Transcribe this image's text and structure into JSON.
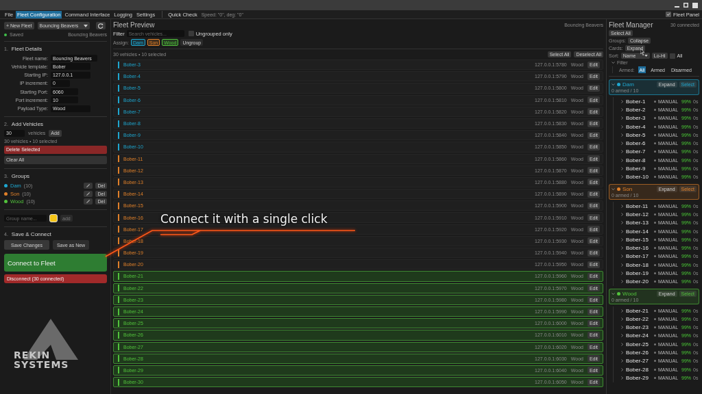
{
  "fleet_panel_toggle": {
    "label": "Fleet Panel",
    "checked": true
  },
  "menu": [
    {
      "label": "File",
      "selected": false
    },
    {
      "label": "Fleet Configuration",
      "selected": true
    },
    {
      "label": "Command Interface",
      "selected": false
    },
    {
      "label": "Logging",
      "selected": false
    },
    {
      "label": "Settings",
      "selected": false
    }
  ],
  "quick_check": {
    "label": "Quick Check",
    "status": "Speed: \"0\", deg: \"0\""
  },
  "left": {
    "new_fleet": "+ New Fleet",
    "fleet_select": "Bouncing Beavers",
    "save_status": "Saved",
    "saved": true,
    "fleet_hint": "Bouncing Beavers",
    "details": {
      "number": "1.",
      "title": "Fleet Details",
      "fields": [
        {
          "label": "Fleet name:",
          "value": "Bouncing Beavers"
        },
        {
          "label": "Vehicle template:",
          "value": "Bober"
        },
        {
          "label": "Starting IP:",
          "value": "127.0.0.1"
        },
        {
          "label": "IP increment:",
          "value": "0"
        },
        {
          "label": "Starting Port:",
          "value": "6060"
        },
        {
          "label": "Port increment:",
          "value": "10"
        },
        {
          "label": "Payload Type:",
          "value": "Wood"
        }
      ]
    },
    "add": {
      "number": "2.",
      "title": "Add Vehicles",
      "count": "30",
      "unit": "vehicles",
      "add_button": "Add",
      "summary": "30 vehicles • 10 selected",
      "delete_button": "Delete Selected",
      "clear_button": "Clear All"
    },
    "groups": {
      "number": "3.",
      "title": "Groups",
      "items": [
        {
          "name": "Dam",
          "count": "(10)",
          "color": "#1ea7d0",
          "delete": "Del"
        },
        {
          "name": "Son",
          "count": "(10)",
          "color": "#e0802a",
          "delete": "Del"
        },
        {
          "name": "Wood",
          "count": "(10)",
          "color": "#52c23c",
          "delete": "Del"
        }
      ],
      "new_group": {
        "placeholder": "Group name...",
        "color": "#f5c518",
        "add_button": "add"
      }
    },
    "save": {
      "number": "4.",
      "title": "Save & Connect",
      "save_changes": "Save Changes",
      "save_new": "Save as New",
      "connect": "Connect to Fleet",
      "disconnect": "Disconnect (30 connected)"
    },
    "logo": {
      "line1": "REKIN",
      "line2": "SYSTEMS"
    }
  },
  "preview": {
    "title": "Fleet Preview",
    "fleet": "Bouncing Beavers",
    "filter_label": "Filter",
    "search_placeholder": "Search vehicles...",
    "ungrouped": {
      "label": "Ungrouped only",
      "checked": false
    },
    "assign_label": "Assign:",
    "assign": [
      {
        "label": "Dam",
        "color": "#1ea7d0"
      },
      {
        "label": "Son",
        "color": "#e0802a"
      },
      {
        "label": "Wood",
        "color": "#52c23c"
      }
    ],
    "ungroup": "Ungroup",
    "summary": "30 vehicles • 10 selected",
    "select_all": "Select All",
    "deselect_all": "Deselect All",
    "rows": [
      {
        "name": "Bober-3",
        "address": "127.0.0.1:5780",
        "payload": "Wood",
        "color": "#1ea7d0",
        "selected": false,
        "edit": "Edit"
      },
      {
        "name": "Bober-4",
        "address": "127.0.0.1:5790",
        "payload": "Wood",
        "color": "#1ea7d0",
        "selected": false,
        "edit": "Edit"
      },
      {
        "name": "Bober-5",
        "address": "127.0.0.1:5800",
        "payload": "Wood",
        "color": "#1ea7d0",
        "selected": false,
        "edit": "Edit"
      },
      {
        "name": "Bober-6",
        "address": "127.0.0.1:5810",
        "payload": "Wood",
        "color": "#1ea7d0",
        "selected": false,
        "edit": "Edit"
      },
      {
        "name": "Bober-7",
        "address": "127.0.0.1:5820",
        "payload": "Wood",
        "color": "#1ea7d0",
        "selected": false,
        "edit": "Edit"
      },
      {
        "name": "Bober-8",
        "address": "127.0.0.1:5830",
        "payload": "Wood",
        "color": "#1ea7d0",
        "selected": false,
        "edit": "Edit"
      },
      {
        "name": "Bober-9",
        "address": "127.0.0.1:5840",
        "payload": "Wood",
        "color": "#1ea7d0",
        "selected": false,
        "edit": "Edit"
      },
      {
        "name": "Bober-10",
        "address": "127.0.0.1:5850",
        "payload": "Wood",
        "color": "#1ea7d0",
        "selected": false,
        "edit": "Edit"
      },
      {
        "name": "Bober-11",
        "address": "127.0.0.1:5860",
        "payload": "Wood",
        "color": "#e0802a",
        "selected": false,
        "edit": "Edit"
      },
      {
        "name": "Bober-12",
        "address": "127.0.0.1:5870",
        "payload": "Wood",
        "color": "#e0802a",
        "selected": false,
        "edit": "Edit"
      },
      {
        "name": "Bober-13",
        "address": "127.0.0.1:5880",
        "payload": "Wood",
        "color": "#e0802a",
        "selected": false,
        "edit": "Edit"
      },
      {
        "name": "Bober-14",
        "address": "127.0.0.1:5890",
        "payload": "Wood",
        "color": "#e0802a",
        "selected": false,
        "edit": "Edit"
      },
      {
        "name": "Bober-15",
        "address": "127.0.0.1:5900",
        "payload": "Wood",
        "color": "#e0802a",
        "selected": false,
        "edit": "Edit"
      },
      {
        "name": "Bober-16",
        "address": "127.0.0.1:5910",
        "payload": "Wood",
        "color": "#e0802a",
        "selected": false,
        "edit": "Edit"
      },
      {
        "name": "Bober-17",
        "address": "127.0.0.1:5920",
        "payload": "Wood",
        "color": "#e0802a",
        "selected": false,
        "edit": "Edit"
      },
      {
        "name": "Bober-18",
        "address": "127.0.0.1:5930",
        "payload": "Wood",
        "color": "#e0802a",
        "selected": false,
        "edit": "Edit"
      },
      {
        "name": "Bober-19",
        "address": "127.0.0.1:5940",
        "payload": "Wood",
        "color": "#e0802a",
        "selected": false,
        "edit": "Edit"
      },
      {
        "name": "Bober-20",
        "address": "127.0.0.1:5950",
        "payload": "Wood",
        "color": "#e0802a",
        "selected": false,
        "edit": "Edit"
      },
      {
        "name": "Bober-21",
        "address": "127.0.0.1:5960",
        "payload": "Wood",
        "color": "#52c23c",
        "selected": true,
        "edit": "Edit"
      },
      {
        "name": "Bober-22",
        "address": "127.0.0.1:5970",
        "payload": "Wood",
        "color": "#52c23c",
        "selected": true,
        "edit": "Edit"
      },
      {
        "name": "Bober-23",
        "address": "127.0.0.1:5980",
        "payload": "Wood",
        "color": "#52c23c",
        "selected": true,
        "edit": "Edit"
      },
      {
        "name": "Bober-24",
        "address": "127.0.0.1:5990",
        "payload": "Wood",
        "color": "#52c23c",
        "selected": true,
        "edit": "Edit"
      },
      {
        "name": "Bober-25",
        "address": "127.0.0.1:6000",
        "payload": "Wood",
        "color": "#52c23c",
        "selected": true,
        "edit": "Edit"
      },
      {
        "name": "Bober-26",
        "address": "127.0.0.1:6010",
        "payload": "Wood",
        "color": "#52c23c",
        "selected": true,
        "edit": "Edit"
      },
      {
        "name": "Bober-27",
        "address": "127.0.0.1:6020",
        "payload": "Wood",
        "color": "#52c23c",
        "selected": true,
        "edit": "Edit"
      },
      {
        "name": "Bober-28",
        "address": "127.0.0.1:6030",
        "payload": "Wood",
        "color": "#52c23c",
        "selected": true,
        "edit": "Edit"
      },
      {
        "name": "Bober-29",
        "address": "127.0.0.1:6040",
        "payload": "Wood",
        "color": "#52c23c",
        "selected": true,
        "edit": "Edit"
      },
      {
        "name": "Bober-30",
        "address": "127.0.0.1:6050",
        "payload": "Wood",
        "color": "#52c23c",
        "selected": true,
        "edit": "Edit"
      }
    ]
  },
  "callout": {
    "text": "Connect it with a single click"
  },
  "manager": {
    "title": "Fleet Manager",
    "connected": "30 connected",
    "select_all": "Select All",
    "groups_label": "Groups:",
    "collapse": "Collapse",
    "cards_label": "Cards:",
    "expand": "Expand",
    "sort_label": "Sort:",
    "sort_value": "Name",
    "order": "Lo-Hi",
    "all": {
      "label": "All",
      "checked": false
    },
    "filter": "Filter",
    "filter_expanded": true,
    "armed_label": "Armed:",
    "armed_options": [
      {
        "label": "All",
        "selected": true
      },
      {
        "label": "Armed",
        "selected": false
      },
      {
        "label": "Disarmed",
        "selected": false
      }
    ],
    "groups": [
      {
        "name": "Dam",
        "color": "#1ea7d0",
        "summary": "0 armed / 10",
        "expand": "Expand",
        "select": "Select",
        "expanded": true,
        "vehicles": [
          {
            "name": "Bober-1",
            "mode": "MANUAL",
            "battery": "99%",
            "age": "0s"
          },
          {
            "name": "Bober-2",
            "mode": "MANUAL",
            "battery": "99%",
            "age": "0s"
          },
          {
            "name": "Bober-3",
            "mode": "MANUAL",
            "battery": "99%",
            "age": "0s"
          },
          {
            "name": "Bober-4",
            "mode": "MANUAL",
            "battery": "99%",
            "age": "0s"
          },
          {
            "name": "Bober-5",
            "mode": "MANUAL",
            "battery": "99%",
            "age": "0s"
          },
          {
            "name": "Bober-6",
            "mode": "MANUAL",
            "battery": "99%",
            "age": "0s"
          },
          {
            "name": "Bober-7",
            "mode": "MANUAL",
            "battery": "99%",
            "age": "0s"
          },
          {
            "name": "Bober-8",
            "mode": "MANUAL",
            "battery": "99%",
            "age": "0s"
          },
          {
            "name": "Bober-9",
            "mode": "MANUAL",
            "battery": "99%",
            "age": "0s"
          },
          {
            "name": "Bober-10",
            "mode": "MANUAL",
            "battery": "99%",
            "age": "0s"
          }
        ]
      },
      {
        "name": "Son",
        "color": "#e0802a",
        "summary": "0 armed / 10",
        "expand": "Expand",
        "select": "Select",
        "expanded": true,
        "vehicles": [
          {
            "name": "Bober-11",
            "mode": "MANUAL",
            "battery": "99%",
            "age": "0s"
          },
          {
            "name": "Bober-12",
            "mode": "MANUAL",
            "battery": "99%",
            "age": "0s"
          },
          {
            "name": "Bober-13",
            "mode": "MANUAL",
            "battery": "99%",
            "age": "0s"
          },
          {
            "name": "Bober-14",
            "mode": "MANUAL",
            "battery": "99%",
            "age": "0s"
          },
          {
            "name": "Bober-15",
            "mode": "MANUAL",
            "battery": "99%",
            "age": "0s"
          },
          {
            "name": "Bober-16",
            "mode": "MANUAL",
            "battery": "99%",
            "age": "0s"
          },
          {
            "name": "Bober-17",
            "mode": "MANUAL",
            "battery": "99%",
            "age": "0s"
          },
          {
            "name": "Bober-18",
            "mode": "MANUAL",
            "battery": "99%",
            "age": "0s"
          },
          {
            "name": "Bober-19",
            "mode": "MANUAL",
            "battery": "99%",
            "age": "0s"
          },
          {
            "name": "Bober-20",
            "mode": "MANUAL",
            "battery": "99%",
            "age": "0s"
          }
        ]
      },
      {
        "name": "Wood",
        "color": "#52c23c",
        "summary": "0 armed / 10",
        "expand": "Expand",
        "select": "Select",
        "expanded": true,
        "vehicles": [
          {
            "name": "Bober-21",
            "mode": "MANUAL",
            "battery": "99%",
            "age": "0s"
          },
          {
            "name": "Bober-22",
            "mode": "MANUAL",
            "battery": "99%",
            "age": "0s"
          },
          {
            "name": "Bober-23",
            "mode": "MANUAL",
            "battery": "99%",
            "age": "0s"
          },
          {
            "name": "Bober-24",
            "mode": "MANUAL",
            "battery": "99%",
            "age": "0s"
          },
          {
            "name": "Bober-25",
            "mode": "MANUAL",
            "battery": "99%",
            "age": "0s"
          },
          {
            "name": "Bober-26",
            "mode": "MANUAL",
            "battery": "99%",
            "age": "0s"
          },
          {
            "name": "Bober-27",
            "mode": "MANUAL",
            "battery": "99%",
            "age": "0s"
          },
          {
            "name": "Bober-28",
            "mode": "MANUAL",
            "battery": "99%",
            "age": "0s"
          },
          {
            "name": "Bober-29",
            "mode": "MANUAL",
            "battery": "99%",
            "age": "0s"
          }
        ]
      }
    ]
  }
}
